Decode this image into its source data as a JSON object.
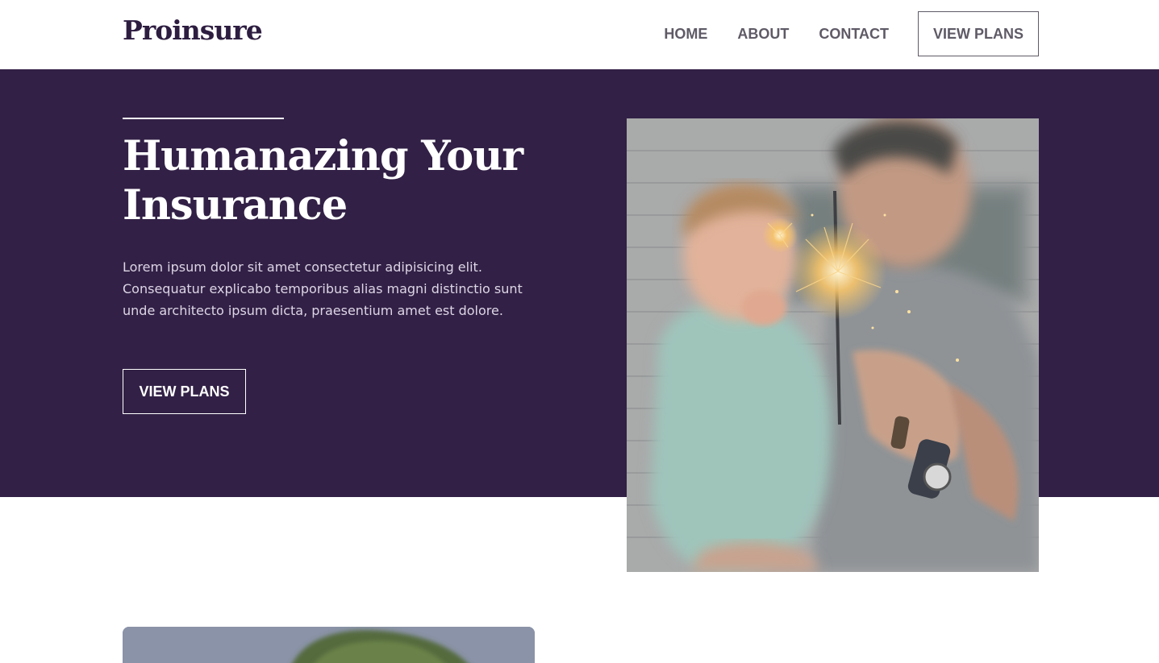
{
  "brand": {
    "name": "Proinsure"
  },
  "nav": {
    "items": [
      {
        "label": "HOME"
      },
      {
        "label": "ABOUT"
      },
      {
        "label": "CONTACT"
      }
    ],
    "cta_label": "VIEW PLANS"
  },
  "hero": {
    "title": "Humanazing Your Insurance",
    "body": "Lorem ipsum dolor sit amet consectetur adipisicing elit. Consequatur explicabo temporibus alias magni distinctio sunt unde architecto ipsum dicta, praesentium amet est dolore.",
    "cta_label": "VIEW PLANS"
  },
  "colors": {
    "hero_background": "#322046",
    "brand_text": "#2d1d40",
    "nav_text": "#5f5a66",
    "white": "#ffffff"
  },
  "images": {
    "hero_photo": "photo-man-holding-child-with-sparkler",
    "second_photo": "photo-trees-sky"
  }
}
